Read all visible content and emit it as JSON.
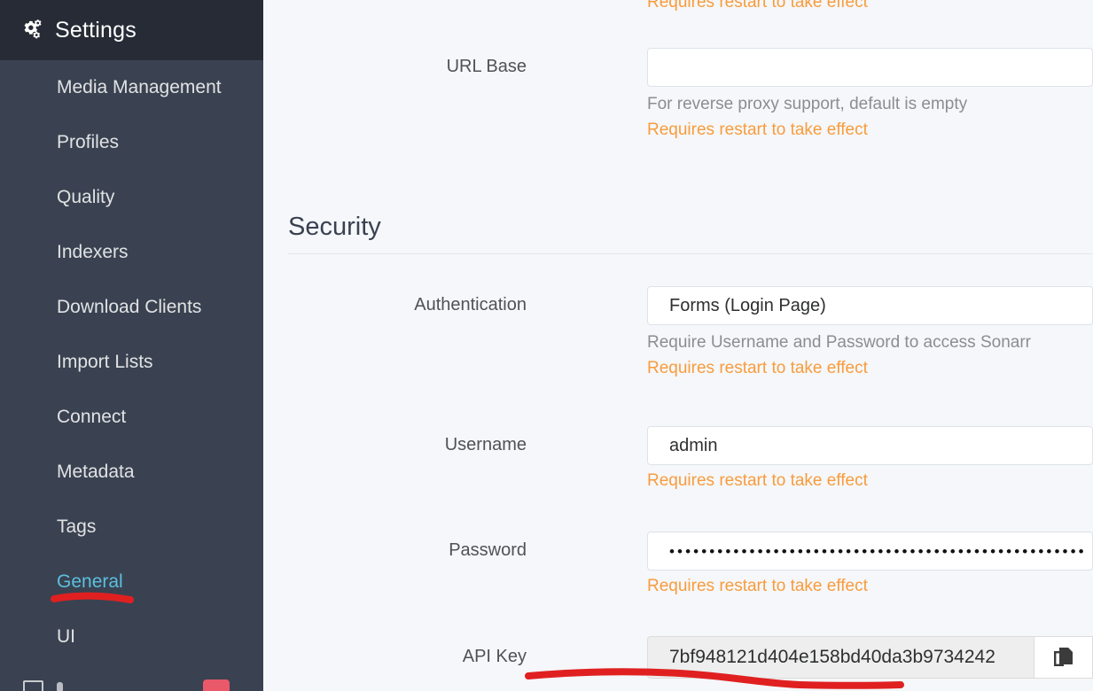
{
  "sidebar": {
    "title": "Settings",
    "title_icon": "cogs-icon",
    "items": [
      {
        "label": "Media Management",
        "active": false
      },
      {
        "label": "Profiles",
        "active": false
      },
      {
        "label": "Quality",
        "active": false
      },
      {
        "label": "Indexers",
        "active": false
      },
      {
        "label": "Download Clients",
        "active": false
      },
      {
        "label": "Import Lists",
        "active": false
      },
      {
        "label": "Connect",
        "active": false
      },
      {
        "label": "Metadata",
        "active": false
      },
      {
        "label": "Tags",
        "active": false
      },
      {
        "label": "General",
        "active": true
      },
      {
        "label": "UI",
        "active": false
      }
    ],
    "active_color": "#5bc0de",
    "background": "#3a4251",
    "header_background": "#262b36"
  },
  "content": {
    "clipped_top_warning": "Requires restart to take effect",
    "url_base": {
      "label": "URL Base",
      "value": "",
      "help": "For reverse proxy support, default is empty",
      "warning": "Requires restart to take effect"
    },
    "security": {
      "heading": "Security",
      "authentication": {
        "label": "Authentication",
        "value": "Forms (Login Page)",
        "help": "Require Username and Password to access Sonarr",
        "warning": "Requires restart to take effect"
      },
      "username": {
        "label": "Username",
        "value": "admin",
        "warning": "Requires restart to take effect"
      },
      "password": {
        "label": "Password",
        "value": "••••••••••••••••••••••••••••••••••••••••••••••••••••",
        "warning": "Requires restart to take effect"
      },
      "api_key": {
        "label": "API Key",
        "value": "7bf948121d404e158bd40da3b9734242",
        "copy_icon": "copy-icon"
      }
    },
    "warning_color": "#f89c3c",
    "background": "#f5f7fa"
  },
  "annotations": {
    "color": "#e02020",
    "strokes": [
      {
        "name": "general-underline"
      },
      {
        "name": "api-key-underline"
      }
    ]
  }
}
